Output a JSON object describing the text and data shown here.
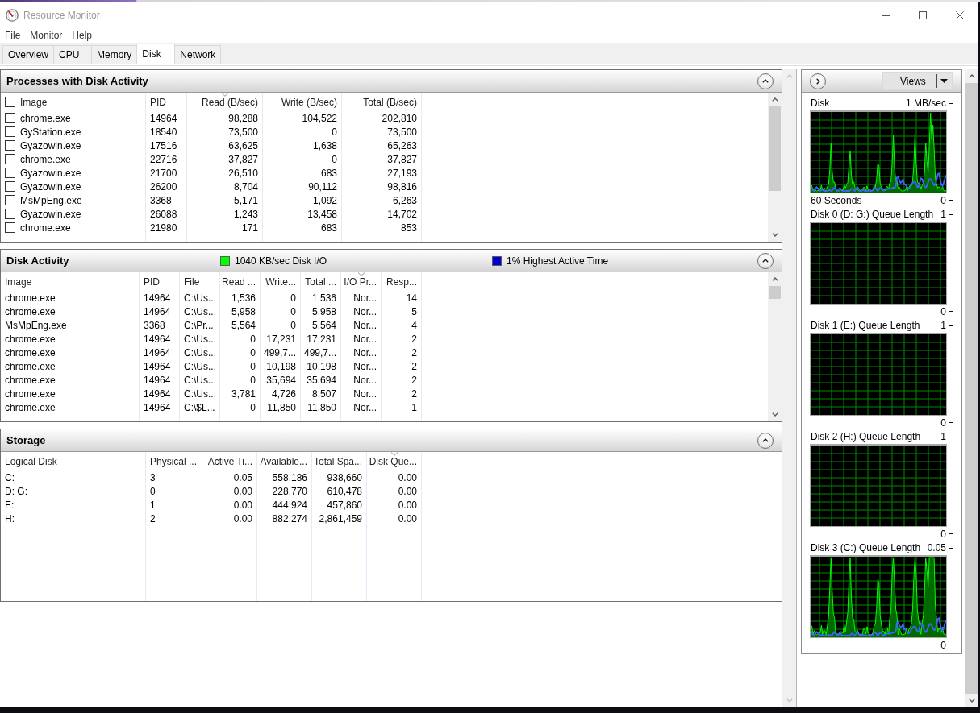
{
  "window": {
    "title": "Resource Monitor"
  },
  "menu": [
    "File",
    "Monitor",
    "Help"
  ],
  "tabs": [
    {
      "label": "Overview",
      "selected": false
    },
    {
      "label": "CPU",
      "selected": false
    },
    {
      "label": "Memory",
      "selected": false
    },
    {
      "label": "Disk",
      "selected": true
    },
    {
      "label": "Network",
      "selected": false
    }
  ],
  "sections": [
    {
      "title": "Processes with Disk Activity",
      "expanded": true,
      "select_all_checked": false,
      "columns": [
        {
          "label": "Image",
          "sorted": false
        },
        {
          "label": "PID",
          "sorted": false
        },
        {
          "label": "Read (B/sec)",
          "sorted": true
        },
        {
          "label": "Write (B/sec)",
          "sorted": false
        },
        {
          "label": "Total (B/sec)",
          "sorted": false
        }
      ],
      "rows": [
        {
          "checked": false,
          "cells": [
            "chrome.exe",
            "14964",
            "98,288",
            "104,522",
            "202,810"
          ]
        },
        {
          "checked": false,
          "cells": [
            "GyStation.exe",
            "18540",
            "73,500",
            "0",
            "73,500"
          ]
        },
        {
          "checked": false,
          "cells": [
            "Gyazowin.exe",
            "17516",
            "63,625",
            "1,638",
            "65,263"
          ]
        },
        {
          "checked": false,
          "cells": [
            "chrome.exe",
            "22716",
            "37,827",
            "0",
            "37,827"
          ]
        },
        {
          "checked": false,
          "cells": [
            "Gyazowin.exe",
            "21700",
            "26,510",
            "683",
            "27,193"
          ]
        },
        {
          "checked": false,
          "cells": [
            "Gyazowin.exe",
            "26200",
            "8,704",
            "90,112",
            "98,816"
          ]
        },
        {
          "checked": false,
          "cells": [
            "MsMpEng.exe",
            "3368",
            "5,171",
            "1,092",
            "6,263"
          ]
        },
        {
          "checked": false,
          "cells": [
            "Gyazowin.exe",
            "26088",
            "1,243",
            "13,458",
            "14,702"
          ]
        },
        {
          "checked": false,
          "cells": [
            "chrome.exe",
            "21980",
            "171",
            "683",
            "853"
          ]
        }
      ]
    },
    {
      "title": "Disk Activity",
      "expanded": true,
      "legend": [
        {
          "label": "1040 KB/sec Disk I/O",
          "color": "#00ff00"
        },
        {
          "label": "1% Highest Active Time",
          "color": "#0000d0"
        }
      ],
      "columns": [
        {
          "label": "Image",
          "sorted": false
        },
        {
          "label": "PID",
          "sorted": false
        },
        {
          "label": "File",
          "sorted": false
        },
        {
          "label": "Read ...",
          "sorted": false
        },
        {
          "label": "Write...",
          "sorted": false
        },
        {
          "label": "Total ...",
          "sorted": false
        },
        {
          "label": "I/O Pr...",
          "sorted": true
        },
        {
          "label": "Resp...",
          "sorted": false
        }
      ],
      "rows": [
        {
          "cells": [
            "chrome.exe",
            "14964",
            "C:\\Us...",
            "1,536",
            "0",
            "1,536",
            "Nor...",
            "14"
          ]
        },
        {
          "cells": [
            "chrome.exe",
            "14964",
            "C:\\Us...",
            "5,958",
            "0",
            "5,958",
            "Nor...",
            "5"
          ]
        },
        {
          "cells": [
            "MsMpEng.exe",
            "3368",
            "C:\\Pr...",
            "5,564",
            "0",
            "5,564",
            "Nor...",
            "4"
          ]
        },
        {
          "cells": [
            "chrome.exe",
            "14964",
            "C:\\Us...",
            "0",
            "17,231",
            "17,231",
            "Nor...",
            "2"
          ]
        },
        {
          "cells": [
            "chrome.exe",
            "14964",
            "C:\\Us...",
            "0",
            "499,7...",
            "499,7...",
            "Nor...",
            "2"
          ]
        },
        {
          "cells": [
            "chrome.exe",
            "14964",
            "C:\\Us...",
            "0",
            "10,198",
            "10,198",
            "Nor...",
            "2"
          ]
        },
        {
          "cells": [
            "chrome.exe",
            "14964",
            "C:\\Us...",
            "0",
            "35,694",
            "35,694",
            "Nor...",
            "2"
          ]
        },
        {
          "cells": [
            "chrome.exe",
            "14964",
            "C:\\Us...",
            "3,781",
            "4,726",
            "8,507",
            "Nor...",
            "2"
          ]
        },
        {
          "cells": [
            "chrome.exe",
            "14964",
            "C:\\$L...",
            "0",
            "11,850",
            "11,850",
            "Nor...",
            "1"
          ]
        }
      ]
    },
    {
      "title": "Storage",
      "expanded": true,
      "columns": [
        {
          "label": "Logical Disk",
          "sorted": false
        },
        {
          "label": "Physical ...",
          "sorted": false
        },
        {
          "label": "Active Ti...",
          "sorted": false
        },
        {
          "label": "Available...",
          "sorted": false
        },
        {
          "label": "Total Spa...",
          "sorted": false
        },
        {
          "label": "Disk Que...",
          "sorted": true
        }
      ],
      "rows": [
        {
          "cells": [
            "C:",
            "3",
            "0.05",
            "558,186",
            "938,660",
            "0.00"
          ]
        },
        {
          "cells": [
            "D: G:",
            "0",
            "0.00",
            "228,770",
            "610,478",
            "0.00"
          ]
        },
        {
          "cells": [
            "E:",
            "1",
            "0.00",
            "444,924",
            "457,860",
            "0.00"
          ]
        },
        {
          "cells": [
            "H:",
            "2",
            "0.00",
            "882,274",
            "2,861,459",
            "0.00"
          ]
        }
      ]
    }
  ],
  "graph_panel": {
    "views_button": "Views",
    "graphs": [
      {
        "title": "Disk",
        "scale_max": "1 MB/sec",
        "time_span": "60 Seconds",
        "scale_min": "0",
        "active": true
      },
      {
        "title": "Disk 0 (D: G:) Queue Length",
        "scale_max": "1",
        "scale_min": "0",
        "active": false
      },
      {
        "title": "Disk 1 (E:) Queue Length",
        "scale_max": "1",
        "scale_min": "0",
        "active": false
      },
      {
        "title": "Disk 2 (H:) Queue Length",
        "scale_max": "1",
        "scale_min": "0",
        "active": false
      },
      {
        "title": "Disk 3 (C:) Queue Length",
        "scale_max": "0.05",
        "scale_min": "0",
        "active": true
      }
    ]
  }
}
